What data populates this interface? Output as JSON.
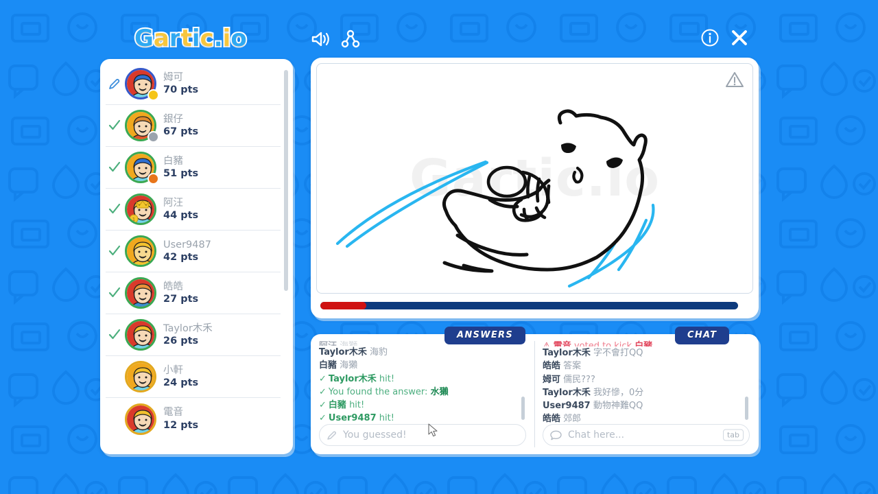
{
  "app": {
    "logo_text": "Gartic.io",
    "logo_letters": [
      "G",
      "a",
      "r",
      "t",
      "i",
      "c",
      ".",
      "i",
      "o"
    ],
    "watermark": "Gartic.io",
    "bg_color": "#1a8cf5"
  },
  "header": {
    "sound_icon": "speaker-icon",
    "network_icon": "share-nodes-icon",
    "info_icon": "info-icon",
    "close_icon": "close-icon"
  },
  "players": {
    "scroll_position": "top",
    "list": [
      {
        "status": "drawing",
        "name": "姆可",
        "points": "70 pts",
        "ring": "ring-blue",
        "dot": "#f5c518",
        "hair": "#2f6fd0",
        "face": "#f6d9b6",
        "bg": "#d93a2b",
        "shirt": "#6fd3e8"
      },
      {
        "status": "guessed",
        "name": "銀仔",
        "points": "67 pts",
        "ring": "ring-green",
        "dot": "#9aa3ad",
        "hair": "#e08a2e",
        "face": "#f6d9b6",
        "bg": "#f0a81e",
        "shirt": "#e2572a"
      },
      {
        "status": "guessed",
        "name": "白豬",
        "points": "51 pts",
        "ring": "ring-green",
        "dot": "#e8751a",
        "hair": "#2f6fd0",
        "face": "#f6d9b6",
        "bg": "#f0a81e",
        "shirt": "#6fd3e8"
      },
      {
        "status": "guessed",
        "name": "阿汪",
        "points": "44 pts",
        "ring": "ring-green",
        "dot": null,
        "hair": "#f2c12e",
        "face": "#f6d9b6",
        "bg": "#d93a2b",
        "shirt": "#6fd3e8",
        "crown": true
      },
      {
        "status": "guessed",
        "name": "User9487",
        "points": "42 pts",
        "ring": "ring-green",
        "dot": null,
        "hair": "#f2c12e",
        "face": "#f7d98f",
        "bg": "#f0a81e",
        "shirt": "#f2c12e"
      },
      {
        "status": "guessed",
        "name": "皓皓",
        "points": "27 pts",
        "ring": "ring-green",
        "dot": null,
        "hair": "#e8913a",
        "face": "#f6d9b6",
        "bg": "#d93a2b",
        "shirt": "#3a8fd0"
      },
      {
        "status": "guessed",
        "name": "Taylor木禾",
        "points": "26 pts",
        "ring": "ring-green",
        "dot": null,
        "hair": "#f2c12e",
        "face": "#f6d9b6",
        "bg": "#d93a2b",
        "shirt": "#6fd3e8"
      },
      {
        "status": "none",
        "name": "小軒",
        "points": "24 pts",
        "ring": "ring-yellow",
        "dot": null,
        "hair": "#f2c12e",
        "face": "#f6d9b6",
        "bg": "#f0a81e",
        "shirt": "#6fd3e8"
      },
      {
        "status": "none",
        "name": "電音",
        "points": "12 pts",
        "ring": "ring-yellow",
        "dot": null,
        "hair": "#f2c12e",
        "face": "#f6d9b6",
        "bg": "#d93a2b",
        "shirt": "#6fd3e8"
      }
    ]
  },
  "canvas": {
    "warning_icon": "warning-triangle-icon",
    "progress_percent": 11,
    "progress_fill_color": "#cf1212",
    "progress_track_color": "#0d3a7d",
    "drawing_description": "otter floating on its back holding a shell"
  },
  "tabs": {
    "answers_label": "ANSWERS",
    "chat_label": "CHAT"
  },
  "answers": {
    "messages": [
      {
        "type": "guess",
        "name": "阿汪",
        "text": "海獅",
        "cut": true
      },
      {
        "type": "guess",
        "name": "Taylor木禾",
        "text": "海豹"
      },
      {
        "type": "guess",
        "name": "白豬",
        "text": "海獺"
      },
      {
        "type": "hit",
        "name": "Taylor木禾",
        "text": "hit!"
      },
      {
        "type": "found",
        "name": "You found the answer:",
        "text": "水獺"
      },
      {
        "type": "hit",
        "name": "白豬",
        "text": "hit!"
      },
      {
        "type": "hit",
        "name": "User9487",
        "text": "hit!"
      }
    ],
    "input_placeholder": "You guessed!",
    "input_value": "",
    "input_icon": "pencil-icon"
  },
  "chat": {
    "messages": [
      {
        "type": "kick",
        "name": "電音",
        "text": "voted to kick",
        "target": "白豬",
        "cut": true
      },
      {
        "type": "msg",
        "name": "Taylor木禾",
        "text": "字不會打QQ"
      },
      {
        "type": "msg",
        "name": "皓皓",
        "text": "答案"
      },
      {
        "type": "msg",
        "name": "姆可",
        "text": "儒民???"
      },
      {
        "type": "msg",
        "name": "Taylor木禾",
        "text": "我好慘，0分"
      },
      {
        "type": "msg",
        "name": "User9487",
        "text": "動物神難QQ"
      },
      {
        "type": "msg",
        "name": "皓皓",
        "text": "郊郎"
      }
    ],
    "input_placeholder": "Chat here...",
    "input_value": "",
    "input_icon": "chat-bubble-icon",
    "tab_key_label": "tab"
  }
}
